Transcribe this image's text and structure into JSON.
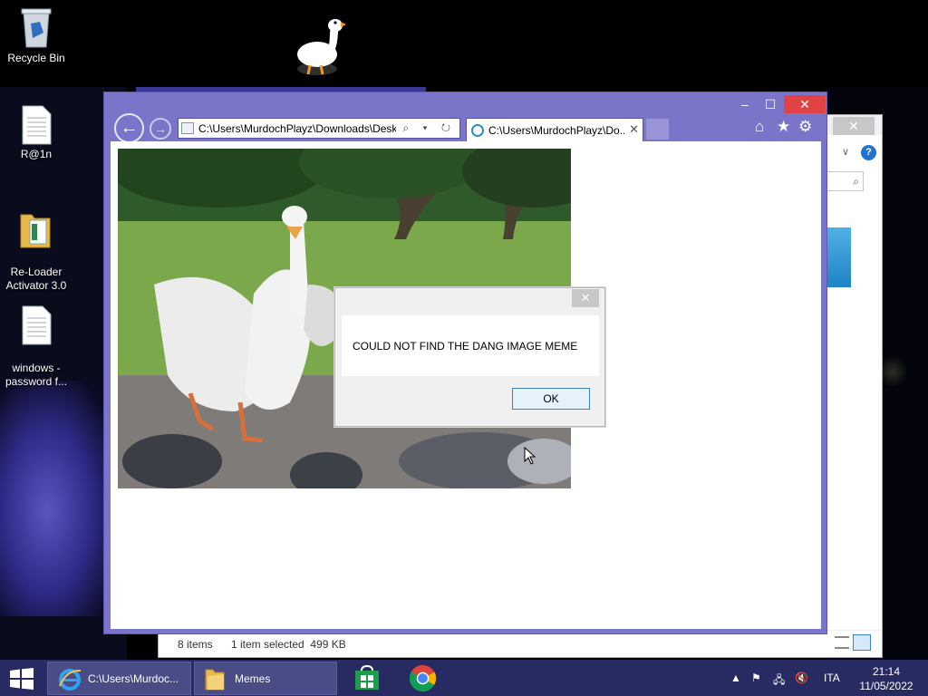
{
  "desktop": {
    "icons": [
      {
        "name": "recycle-bin-icon",
        "label": "Recycle Bin"
      },
      {
        "name": "text-file-icon",
        "label": "R@1n"
      },
      {
        "name": "folder-icon",
        "label": "Re-Loader\nActivator 3.0"
      },
      {
        "name": "text-file-icon",
        "label": "windows -\npassword f..."
      }
    ]
  },
  "browser": {
    "address": "C:\\Users\\MurdochPlayz\\Downloads\\Desktop",
    "address_tools": "⌕ ▾ ↻",
    "tab_title": "C:\\Users\\MurdochPlayz\\Do...",
    "tab_close": "✕",
    "window_controls": {
      "minimize": "–",
      "maximize": "☐",
      "close": "✕"
    },
    "toolbar_icons": [
      "home-icon",
      "favorites-star-icon",
      "settings-gear-icon"
    ]
  },
  "explorer": {
    "status_items": "8 items",
    "status_selected": "1 item selected  499 KB",
    "help": "?",
    "search_glyph": "⌕",
    "close_glyph": "✕",
    "chevron": "∨"
  },
  "dialog": {
    "message": "COULD NOT FIND THE DANG IMAGE MEME",
    "ok_label": "OK",
    "close_glyph": "✕"
  },
  "taskbar": {
    "ie_label": "C:\\Users\\Murdoc...",
    "explorer_label": "Memes",
    "language": "ITA",
    "time": "21:14",
    "date": "11/05/2022",
    "tray_icons": [
      "show-hidden-icons-arrow",
      "action-center-flag-icon",
      "network-icon",
      "volume-muted-icon"
    ]
  },
  "colors": {
    "ie_frame": "#7a75c9",
    "close_red": "#e04343",
    "taskbar": "#282a62",
    "dialog_button_border": "#3c7fb1"
  }
}
